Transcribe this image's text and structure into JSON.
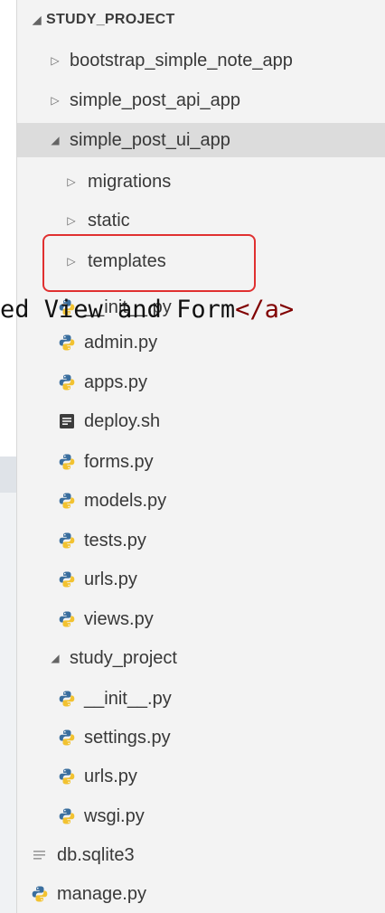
{
  "explorer": {
    "project_title": "STUDY_PROJECT",
    "folders": {
      "bootstrap_simple_note_app": "bootstrap_simple_note_app",
      "simple_post_api_app": "simple_post_api_app",
      "simple_post_ui_app": "simple_post_ui_app",
      "migrations": "migrations",
      "static": "static",
      "templates": "templates",
      "study_project": "study_project"
    },
    "app_files": [
      {
        "name": "__init__.py",
        "icon": "python-icon"
      },
      {
        "name": "admin.py",
        "icon": "python-icon"
      },
      {
        "name": "apps.py",
        "icon": "python-icon"
      },
      {
        "name": "deploy.sh",
        "icon": "shell-script-icon"
      },
      {
        "name": "forms.py",
        "icon": "python-icon"
      },
      {
        "name": "models.py",
        "icon": "python-icon"
      },
      {
        "name": "tests.py",
        "icon": "python-icon"
      },
      {
        "name": "urls.py",
        "icon": "python-icon"
      },
      {
        "name": "views.py",
        "icon": "python-icon"
      }
    ],
    "project_files": [
      {
        "name": "__init__.py",
        "icon": "python-icon"
      },
      {
        "name": "settings.py",
        "icon": "python-icon"
      },
      {
        "name": "urls.py",
        "icon": "python-icon"
      },
      {
        "name": "wsgi.py",
        "icon": "python-icon"
      }
    ],
    "root_files": [
      {
        "name": "db.sqlite3",
        "icon": "text-file-icon"
      },
      {
        "name": "manage.py",
        "icon": "python-icon"
      }
    ]
  },
  "code_overlay": {
    "text": "ed View and Form",
    "closing_tag": "</a>"
  },
  "colors": {
    "highlight_border": "#e03030",
    "python_blue": "#3a6e9e",
    "python_yellow": "#f2c230",
    "selected_row": "#dcdcdc",
    "panel_bg": "#f3f3f3",
    "html_tag": "#800000"
  }
}
